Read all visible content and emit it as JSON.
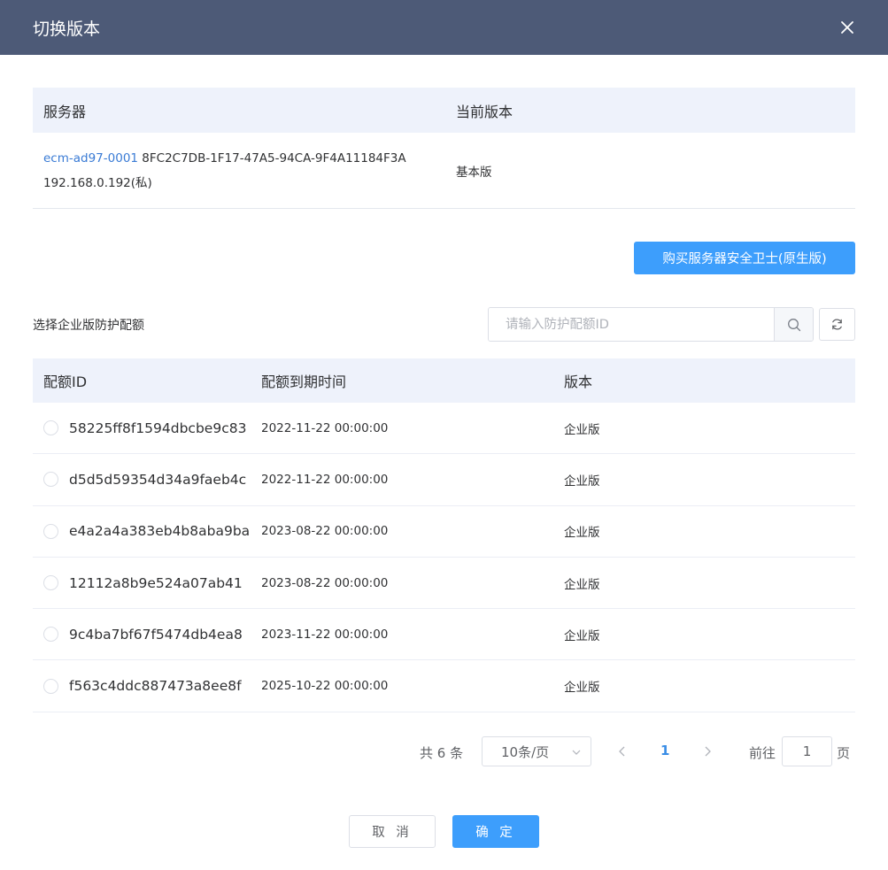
{
  "dialog": {
    "title": "切换版本",
    "close_icon": "close-icon"
  },
  "server_table": {
    "headers": [
      "服务器",
      "当前版本"
    ],
    "row": {
      "server_name": "ecm-ad97-0001",
      "server_id": "8FC2C7DB-1F17-47A5-94CA-9F4A11184F3A",
      "ip": "192.168.0.192(私)",
      "version": "基本版"
    }
  },
  "buy_button": "购买服务器安全卫士(原生版)",
  "quota_section": {
    "label": "选择企业版防护配额",
    "search_placeholder": "请输入防护配额ID",
    "headers": [
      "配额ID",
      "配额到期时间",
      "版本"
    ],
    "rows": [
      {
        "id": "58225ff8f1594dbcbe9c83",
        "expire": "2022-11-22 00:00:00",
        "version": "企业版"
      },
      {
        "id": "d5d5d59354d34a9faeb4c",
        "expire": "2022-11-22 00:00:00",
        "version": "企业版"
      },
      {
        "id": "e4a2a4a383eb4b8aba9ba",
        "expire": "2023-08-22 00:00:00",
        "version": "企业版"
      },
      {
        "id": "12112a8b9e524a07ab41",
        "expire": "2023-08-22 00:00:00",
        "version": "企业版"
      },
      {
        "id": "9c4ba7bf67f5474db4ea8",
        "expire": "2023-11-22 00:00:00",
        "version": "企业版"
      },
      {
        "id": "f563c4ddc887473a8ee8f",
        "expire": "2025-10-22 00:00:00",
        "version": "企业版"
      }
    ]
  },
  "pagination": {
    "total": "共 6 条",
    "page_size": "10条/页",
    "current_page": "1",
    "goto_label": "前往",
    "goto_value": "1",
    "page_unit": "页"
  },
  "footer": {
    "cancel": "取 消",
    "confirm": "确 定"
  },
  "colors": {
    "header_bg": "#4d5a77",
    "primary": "#3d9efc",
    "link": "#3a7bd5",
    "table_head_bg": "#eef2fb"
  }
}
